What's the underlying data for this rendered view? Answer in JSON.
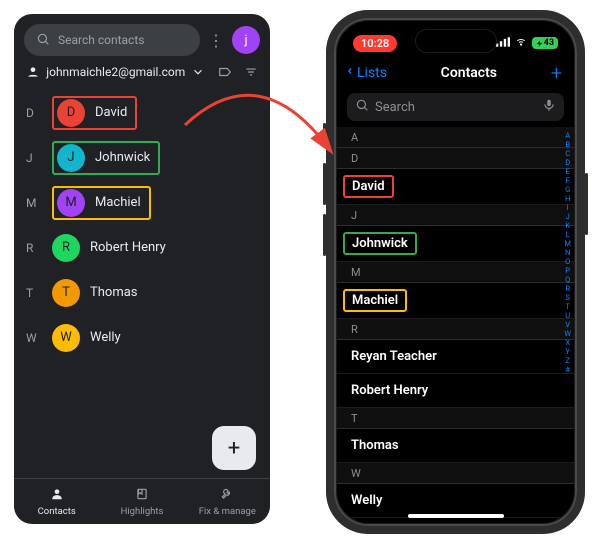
{
  "android": {
    "search_placeholder": "Search contacts",
    "overflow_glyph": "⋮",
    "avatar_initial": "j",
    "avatar_bg": "#a142f4",
    "account_email": "johnmaichle2@gmail.com",
    "contacts": [
      {
        "index": "D",
        "initial": "D",
        "name": "David",
        "chip_bg": "#ea4335",
        "highlight": "#ea4335"
      },
      {
        "index": "J",
        "initial": "J",
        "name": "Johnwick",
        "chip_bg": "#12b5cb",
        "highlight": "#34a853"
      },
      {
        "index": "M",
        "initial": "M",
        "name": "Machiel",
        "chip_bg": "#a142f4",
        "highlight": "#fbbc04"
      },
      {
        "index": "R",
        "initial": "R",
        "name": "Robert Henry",
        "chip_bg": "#1ed760",
        "highlight": null
      },
      {
        "index": "T",
        "initial": "T",
        "name": "Thomas",
        "chip_bg": "#f29900",
        "highlight": null
      },
      {
        "index": "W",
        "initial": "W",
        "name": "Welly",
        "chip_bg": "#fbbc04",
        "highlight": null
      }
    ],
    "fab_glyph": "+",
    "nav": {
      "items": [
        {
          "label": "Contacts",
          "active": true
        },
        {
          "label": "Highlights",
          "active": false
        },
        {
          "label": "Fix & manage",
          "active": false
        }
      ]
    }
  },
  "iphone": {
    "time": "10:28",
    "battery_text": "43",
    "back_label": "Lists",
    "title": "Contacts",
    "plus_glyph": "+",
    "search_placeholder": "Search",
    "sections": [
      {
        "letter": "A",
        "contacts": []
      },
      {
        "letter": "D",
        "contacts": [
          {
            "name": "David",
            "highlight": "#ea4335"
          }
        ]
      },
      {
        "letter": "J",
        "contacts": [
          {
            "name": "Johnwick",
            "highlight": "#34a853"
          }
        ]
      },
      {
        "letter": "M",
        "contacts": [
          {
            "name": "Machiel",
            "highlight": "#fbbc04"
          }
        ]
      },
      {
        "letter": "R",
        "contacts": [
          {
            "name": "Reyan Teacher",
            "highlight": null
          },
          {
            "name": "Robert Henry",
            "highlight": null
          }
        ]
      },
      {
        "letter": "T",
        "contacts": [
          {
            "name": "Thomas",
            "highlight": null
          }
        ]
      },
      {
        "letter": "W",
        "contacts": [
          {
            "name": "Welly",
            "highlight": null
          }
        ]
      }
    ],
    "index_letters": [
      "A",
      "B",
      "C",
      "D",
      "E",
      "F",
      "G",
      "H",
      "I",
      "J",
      "K",
      "L",
      "M",
      "N",
      "O",
      "P",
      "Q",
      "R",
      "S",
      "T",
      "U",
      "V",
      "W",
      "X",
      "Y",
      "Z",
      "#"
    ]
  }
}
